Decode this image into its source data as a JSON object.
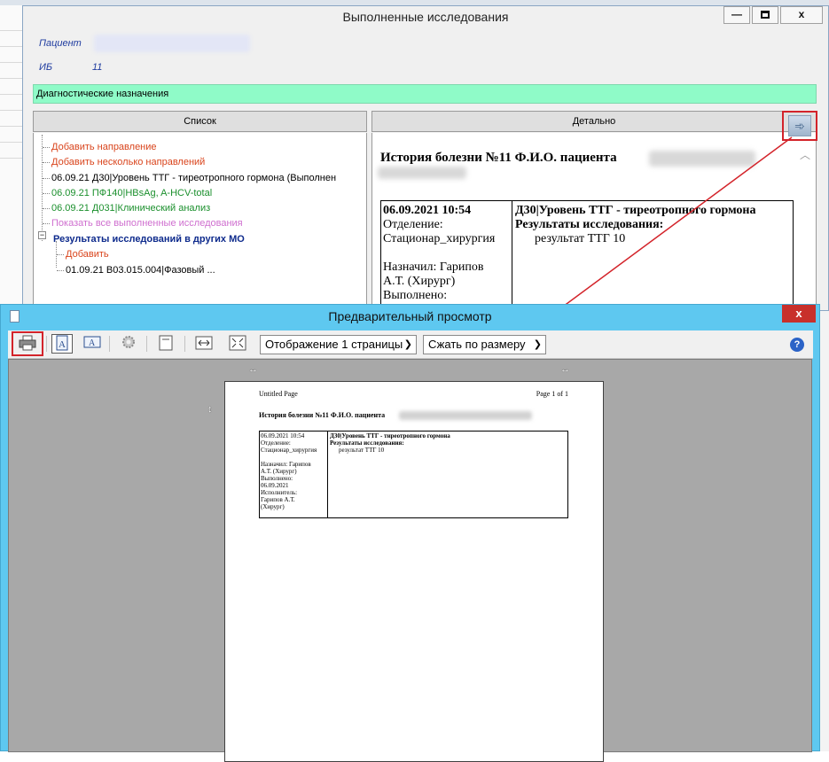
{
  "main_window": {
    "title": "Выполненные исследования",
    "caption_buttons": {
      "minimize": "—",
      "close": "x"
    },
    "patient_label": "Пациент",
    "ib_label": "ИБ",
    "ib_value": "11",
    "section_bar": "Диагностические назначения",
    "list_header": "Список",
    "detail_header": "Детально"
  },
  "tree": {
    "add_direction": "Добавить направление",
    "add_several": "Добавить несколько направлений",
    "item_d30": "06.09.21 Д30|Уровень ТТГ - тиреотропного гормона (Выполнен",
    "item_pf140": "06.09.21 ПФ140|HBsAg, A-HCV-total",
    "item_d031": "06.09.21 Д031|Клинический анализ",
    "show_all": "Показать все выполненные исследования",
    "other_mo": "Результаты исследований в других МО",
    "other_add": "Добавить",
    "other_item": "01.09.21 В03.015.004|Фазовый ...",
    "expander": "−"
  },
  "detail": {
    "title": "История болезни №11 Ф.И.О. пациента",
    "col1": {
      "datetime": "06.09.2021 10:54",
      "dept_label": "Отделение:",
      "dept_value": "Стационар_хирургия",
      "assigned_label": "Назначил: Гарипов",
      "assigned_value": "А.Т. (Хирург)",
      "done_label": "Выполнено:"
    },
    "col2": {
      "test": "Д30|Уровень ТТГ - тиреотропного гормона",
      "results_label": "Результаты исследования:",
      "result": "результат ТТГ 10"
    },
    "export_icon": "export-arrow-icon"
  },
  "preview_window": {
    "title": "Предварительный просмотр",
    "close": "x",
    "pages_select": "Отображение 1 страницы",
    "zoom_select": "Сжать по размеру",
    "help": "?"
  },
  "page": {
    "header_left": "Untitled Page",
    "header_right": "Page 1 of 1",
    "title": "История болезни №11 Ф.И.О. пациента",
    "col1": {
      "datetime": "06.09.2021 10:54",
      "dept_label": "Отделение:",
      "dept_value": "Стационар_хирургия",
      "assigned_label": "Назначил: Гарипов",
      "assigned_value": "А.Т. (Хирург)",
      "done_label": "Выполнено:",
      "done_value": "06.09.2021",
      "executor_label": "Исполнитель:",
      "executor_value": "Гарипов А.Т.",
      "executor_role": "(Хирург)"
    },
    "col2": {
      "test": "Д30|Уровень ТТГ - тиреотропного гормона",
      "results_label": "Результаты исследования:",
      "result": "результат ТТГ 10"
    }
  },
  "colors": {
    "section_bar": "#8ffbc8",
    "preview_title_bg": "#5ec8f0",
    "highlight_red": "#d3232a",
    "link_red": "#d9441c",
    "link_green": "#1a8f2c",
    "link_pink": "#cf6fcf"
  }
}
